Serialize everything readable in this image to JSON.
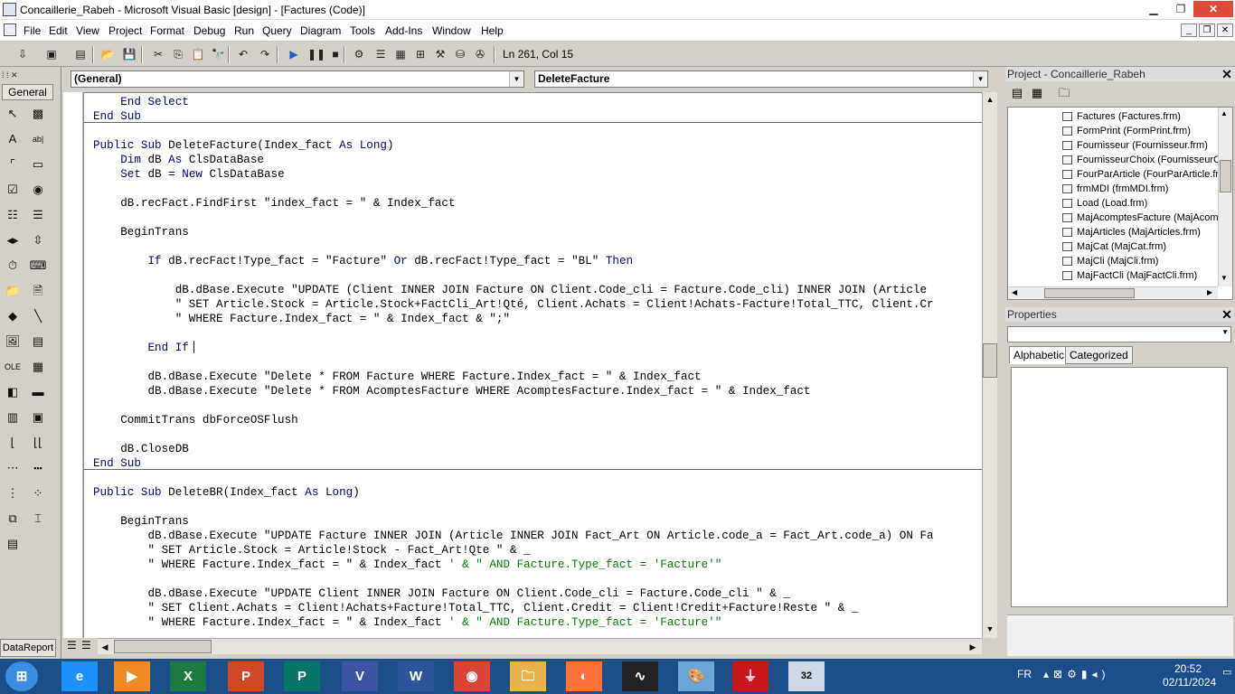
{
  "window": {
    "title": "Concaillerie_Rabeh - Microsoft Visual Basic [design] - [Factures (Code)]",
    "controls": {
      "minimize": "▁",
      "maximize": "❐",
      "close": "✕"
    }
  },
  "menu": {
    "items": [
      "File",
      "Edit",
      "View",
      "Project",
      "Format",
      "Debug",
      "Run",
      "Query",
      "Diagram",
      "Tools",
      "Add-Ins",
      "Window",
      "Help"
    ],
    "mdi_controls": {
      "minimize": "_",
      "restore": "❐",
      "close": "✕"
    }
  },
  "toolbar": {
    "position": "Ln 261, Col 15",
    "icons": [
      "add-project-icon",
      "add-form-icon",
      "menu-editor-icon",
      "open-icon",
      "save-icon",
      "cut-icon",
      "copy-icon",
      "paste-icon",
      "find-icon",
      "undo-icon",
      "redo-icon",
      "start-icon",
      "break-icon",
      "end-icon",
      "project-explorer-icon",
      "properties-window-icon",
      "form-layout-icon",
      "object-browser-icon",
      "toolbox-icon",
      "data-view-icon",
      "component-manager-icon"
    ],
    "glyphs": [
      "⇩",
      "▣",
      "▤",
      "📂",
      "💾",
      "✂",
      "⎘",
      "📋",
      "🔭",
      "↶",
      "↷",
      "▶",
      "❚❚",
      "■",
      "⚙",
      "☰",
      "▦",
      "⊞",
      "⚒",
      "⛁",
      "✇"
    ]
  },
  "toolbox": {
    "tab_label": "General",
    "footer_tab": "DataReport",
    "tools": [
      {
        "name": "pointer-icon",
        "glyph": "↖"
      },
      {
        "name": "picturebox-icon",
        "glyph": "▩"
      },
      {
        "name": "label-icon",
        "glyph": "A"
      },
      {
        "name": "textbox-icon",
        "glyph": "ab|"
      },
      {
        "name": "frame-icon",
        "glyph": "⌜"
      },
      {
        "name": "commandbutton-icon",
        "glyph": "▭"
      },
      {
        "name": "checkbox-icon",
        "glyph": "☑"
      },
      {
        "name": "optionbutton-icon",
        "glyph": "◉"
      },
      {
        "name": "combobox-icon",
        "glyph": "☷"
      },
      {
        "name": "listbox-icon",
        "glyph": "☰"
      },
      {
        "name": "hscrollbar-icon",
        "glyph": "◂▸"
      },
      {
        "name": "vscrollbar-icon",
        "glyph": "⇳"
      },
      {
        "name": "timer-icon",
        "glyph": "⏱"
      },
      {
        "name": "drivelistbox-icon",
        "glyph": "⌨"
      },
      {
        "name": "dirlistbox-icon",
        "glyph": "📁"
      },
      {
        "name": "filelistbox-icon",
        "glyph": "🗎"
      },
      {
        "name": "shape-icon",
        "glyph": "◆"
      },
      {
        "name": "line-icon",
        "glyph": "╲"
      },
      {
        "name": "image-icon",
        "glyph": "🖼"
      },
      {
        "name": "data-icon",
        "glyph": "▤"
      },
      {
        "name": "ole-icon",
        "glyph": "OLE"
      },
      {
        "name": "grid-icon",
        "glyph": "▦"
      },
      {
        "name": "adodc-icon",
        "glyph": "◧"
      },
      {
        "name": "datacombo-icon",
        "glyph": "▬"
      },
      {
        "name": "datagrid-icon",
        "glyph": "▥"
      },
      {
        "name": "datalist-icon",
        "glyph": "▣"
      },
      {
        "name": "rptlabel-icon",
        "glyph": "⌊"
      },
      {
        "name": "rpttextbox-icon",
        "glyph": "⌊⌊"
      },
      {
        "name": "rptimage-icon",
        "glyph": "⋯"
      },
      {
        "name": "rptline-icon",
        "glyph": "▪▪▪"
      },
      {
        "name": "rptshape-icon",
        "glyph": "⋮"
      },
      {
        "name": "rptfunction-icon",
        "glyph": "⁘"
      },
      {
        "name": "tabstrip-icon",
        "glyph": "⧉"
      },
      {
        "name": "toolbar-ctl-icon",
        "glyph": "⌶"
      },
      {
        "name": "statusbar-icon",
        "glyph": "▤"
      }
    ]
  },
  "code": {
    "object_combo": "(General)",
    "procedure_combo": "DeleteFacture",
    "lines": [
      [
        {
          "t": "    "
        },
        {
          "k": "End Select"
        }
      ],
      [
        {
          "k": "End Sub"
        }
      ],
      [],
      [
        {
          "k": "Public Sub "
        },
        {
          "t": "DeleteFacture(Index_fact "
        },
        {
          "k": "As Long"
        },
        {
          "t": ")"
        }
      ],
      [
        {
          "t": "    "
        },
        {
          "k": "Dim "
        },
        {
          "t": "dB "
        },
        {
          "k": "As "
        },
        {
          "t": "ClsDataBase"
        }
      ],
      [
        {
          "t": "    "
        },
        {
          "k": "Set "
        },
        {
          "t": "dB = "
        },
        {
          "k": "New "
        },
        {
          "t": "ClsDataBase"
        }
      ],
      [],
      [
        {
          "t": "    dB.recFact.FindFirst \"index_fact = \" & Index_fact"
        }
      ],
      [],
      [
        {
          "t": "    BeginTrans"
        }
      ],
      [],
      [
        {
          "t": "        "
        },
        {
          "k": "If "
        },
        {
          "t": "dB.recFact!Type_fact = \"Facture\" "
        },
        {
          "k": "Or "
        },
        {
          "t": "dB.recFact!Type_fact = \"BL\" "
        },
        {
          "k": "Then"
        }
      ],
      [],
      [
        {
          "t": "            dB.dBase.Execute \"UPDATE (Client INNER JOIN Facture ON Client.Code_cli = Facture.Code_cli) INNER JOIN (Article"
        }
      ],
      [
        {
          "t": "            \" SET Article.Stock = Article.Stock+FactCli_Art!Qté, Client.Achats = Client!Achats-Facture!Total_TTC, Client.Cr"
        }
      ],
      [
        {
          "t": "            \" WHERE Facture.Index_fact = \" & Index_fact & \";\""
        }
      ],
      [],
      [
        {
          "t": "        "
        },
        {
          "k": "End If"
        }
      ],
      [],
      [
        {
          "t": "        dB.dBase.Execute \"Delete * FROM Facture WHERE Facture.Index_fact = \" & Index_fact"
        }
      ],
      [
        {
          "t": "        dB.dBase.Execute \"Delete * FROM AcomptesFacture WHERE AcomptesFacture.Index_fact = \" & Index_fact"
        }
      ],
      [],
      [
        {
          "t": "    CommitTrans dbForceOSFlush"
        }
      ],
      [],
      [
        {
          "t": "    dB.CloseDB"
        }
      ],
      [
        {
          "k": "End Sub"
        }
      ],
      [],
      [
        {
          "k": "Public Sub "
        },
        {
          "t": "DeleteBR(Index_fact "
        },
        {
          "k": "As Long"
        },
        {
          "t": ")"
        }
      ],
      [],
      [
        {
          "t": "    BeginTrans"
        }
      ],
      [
        {
          "t": "        dB.dBase.Execute \"UPDATE Facture INNER JOIN (Article INNER JOIN Fact_Art ON Article.code_a = Fact_Art.code_a) ON Fa"
        }
      ],
      [
        {
          "t": "        \" SET Article.Stock = Article!Stock - Fact_Art!Qte \" & _"
        }
      ],
      [
        {
          "t": "        \" WHERE Facture.Index_fact = \" & Index_fact "
        },
        {
          "c": "' & \" AND Facture.Type_fact = 'Facture'\""
        }
      ],
      [],
      [
        {
          "t": "        dB.dBase.Execute \"UPDATE Client INNER JOIN Facture ON Client.Code_cli = Facture.Code_cli \" & _"
        }
      ],
      [
        {
          "t": "        \" SET Client.Achats = Client!Achats+Facture!Total_TTC, Client.Credit = Client!Credit+Facture!Reste \" & _"
        }
      ],
      [
        {
          "t": "        \" WHERE Facture.Index_fact = \" & Index_fact "
        },
        {
          "c": "' & \" AND Facture.Type_fact = 'Facture'\""
        }
      ]
    ]
  },
  "project": {
    "title": "Project - Concaillerie_Rabeh",
    "items": [
      "Factures (Factures.frm)",
      "FormPrint (FormPrint.frm)",
      "Fournisseur (Fournisseur.frm)",
      "FournisseurChoix (FournisseurCh",
      "FourParArticle (FourParArticle.fr",
      "frmMDI (frmMDI.frm)",
      "Load (Load.frm)",
      "MajAcomptesFacture (MajAcomp",
      "MajArticles (MajArticles.frm)",
      "MajCat (MajCat.frm)",
      "MajCli (MajCli.frm)",
      "MajFactCli (MajFactCli.frm)"
    ]
  },
  "properties": {
    "title": "Properties",
    "tabs": [
      "Alphabetic",
      "Categorized"
    ]
  },
  "taskbar": {
    "apps": [
      {
        "name": "start-icon",
        "glyph": "⊞",
        "color": "#3c8de0"
      },
      {
        "name": "edge-icon",
        "glyph": "e",
        "color": "#1e90ff"
      },
      {
        "name": "media-player-icon",
        "glyph": "▶",
        "color": "#f08a24"
      },
      {
        "name": "excel-icon",
        "glyph": "X",
        "color": "#1d7a43"
      },
      {
        "name": "powerpoint-icon",
        "glyph": "P",
        "color": "#d24726"
      },
      {
        "name": "publisher-icon",
        "glyph": "P",
        "color": "#077568"
      },
      {
        "name": "visio-icon",
        "glyph": "V",
        "color": "#3955a3"
      },
      {
        "name": "word-icon",
        "glyph": "W",
        "color": "#2b579a"
      },
      {
        "name": "chrome-icon",
        "glyph": "◉",
        "color": "#db4437"
      },
      {
        "name": "file-explorer-icon",
        "glyph": "🗀",
        "color": "#e8b34a"
      },
      {
        "name": "firefox-icon",
        "glyph": "◐",
        "color": "#ff7139"
      },
      {
        "name": "audio-app-icon",
        "glyph": "∿",
        "color": "#222222"
      },
      {
        "name": "paint-icon",
        "glyph": "🎨",
        "color": "#6aa6d8"
      },
      {
        "name": "acrobat-icon",
        "glyph": "⏚",
        "color": "#c8161d"
      },
      {
        "name": "vb6-icon",
        "glyph": "32",
        "color": "#cfd8e6"
      }
    ],
    "language": "FR",
    "time": "20:52",
    "date": "02/11/2024"
  }
}
